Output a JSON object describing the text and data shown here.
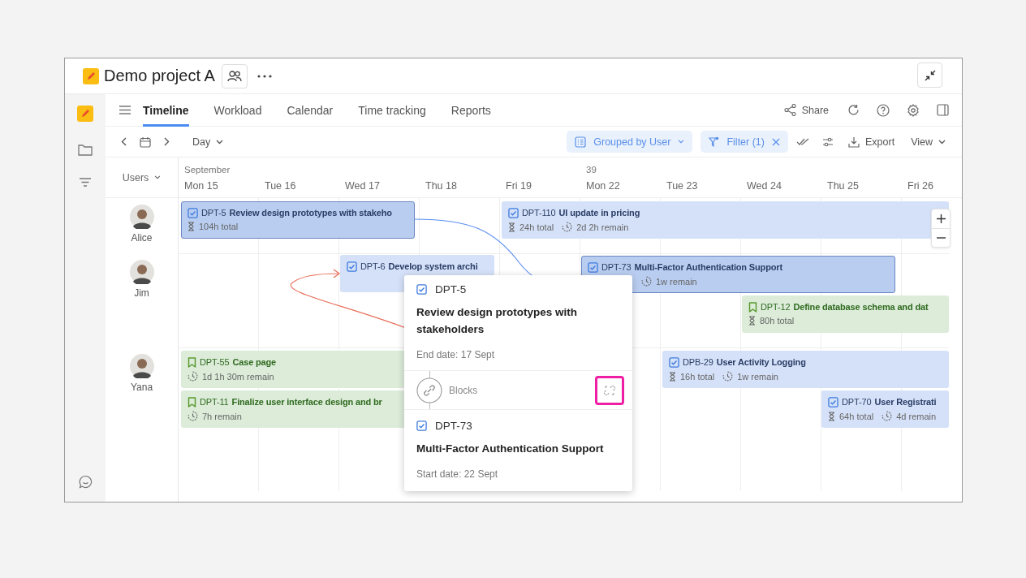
{
  "project": {
    "title": "Demo project A"
  },
  "tabs": [
    {
      "label": "Timeline",
      "selected": true
    },
    {
      "label": "Workload",
      "selected": false
    },
    {
      "label": "Calendar",
      "selected": false
    },
    {
      "label": "Time tracking",
      "selected": false
    },
    {
      "label": "Reports",
      "selected": false
    }
  ],
  "share": {
    "label": "Share"
  },
  "toolbar": {
    "scale": "Day",
    "grouping": "Grouped by User",
    "filter": "Filter (1)",
    "export": "Export",
    "view": "View"
  },
  "timeline": {
    "users_label": "Users",
    "days": [
      {
        "label": "Mon 15",
        "above": "September"
      },
      {
        "label": "Tue 16"
      },
      {
        "label": "Wed 17"
      },
      {
        "label": "Thu 18"
      },
      {
        "label": "Fri 19"
      },
      {
        "label": "Mon 22",
        "above": "39"
      },
      {
        "label": "Tue 23"
      },
      {
        "label": "Wed 24"
      },
      {
        "label": "Thu 25"
      },
      {
        "label": "Fri 26"
      }
    ],
    "users": [
      {
        "name": "Alice",
        "bars": [
          {
            "kind": "task",
            "key": "DPT-5",
            "title": "Review design prototypes with stakeho",
            "selected": true,
            "meta": [
              {
                "kind": "total",
                "text": "104h total"
              }
            ]
          },
          {
            "kind": "task",
            "key": "DPT-110",
            "title": "UI update in pricing",
            "selected": false,
            "meta": [
              {
                "kind": "total",
                "text": "24h total"
              },
              {
                "kind": "remain",
                "text": "2d 2h remain"
              }
            ]
          }
        ]
      },
      {
        "name": "Jim",
        "bars": [
          {
            "kind": "task",
            "key": "DPT-6",
            "title": "Develop system archi",
            "selected": false
          },
          {
            "kind": "task",
            "key": "DPT-73",
            "title": "Multi-Factor Authentication Support",
            "selected": true,
            "meta": [
              {
                "kind": "remain",
                "text": "1w remain"
              }
            ]
          },
          {
            "kind": "story",
            "key": "DPT-12",
            "title": "Define database schema and dat",
            "selected": false,
            "meta": [
              {
                "kind": "total",
                "text": "80h total"
              }
            ]
          }
        ]
      },
      {
        "name": "Yana",
        "bars": [
          {
            "kind": "story",
            "key": "DPT-55",
            "title": "Case page",
            "selected": false,
            "meta": [
              {
                "kind": "remain",
                "text": "1d 1h 30m remain"
              }
            ]
          },
          {
            "kind": "story",
            "key": "DPT-11",
            "title": "Finalize user interface design and br",
            "selected": false,
            "meta": [
              {
                "kind": "remain",
                "text": "7h remain"
              }
            ]
          },
          {
            "kind": "task",
            "key": "DPB-29",
            "title": "User Activity Logging",
            "selected": false,
            "meta": [
              {
                "kind": "total",
                "text": "16h total"
              },
              {
                "kind": "remain",
                "text": "1w remain"
              }
            ]
          },
          {
            "kind": "task",
            "key": "DPT-70",
            "title": "User Registrati",
            "selected": false,
            "meta": [
              {
                "kind": "total",
                "text": "64h total"
              },
              {
                "kind": "remain",
                "text": "4d remain"
              }
            ]
          }
        ]
      }
    ]
  },
  "popup": {
    "from": {
      "key": "DPT-5",
      "title": "Review design prototypes with stakeholders",
      "date": "End date: 17 Sept"
    },
    "relation": {
      "label": "Blocks",
      "unlink_highlighted": true
    },
    "to": {
      "key": "DPT-73",
      "title": "Multi-Factor Authentication Support",
      "date": "Start date: 22 Sept"
    }
  }
}
